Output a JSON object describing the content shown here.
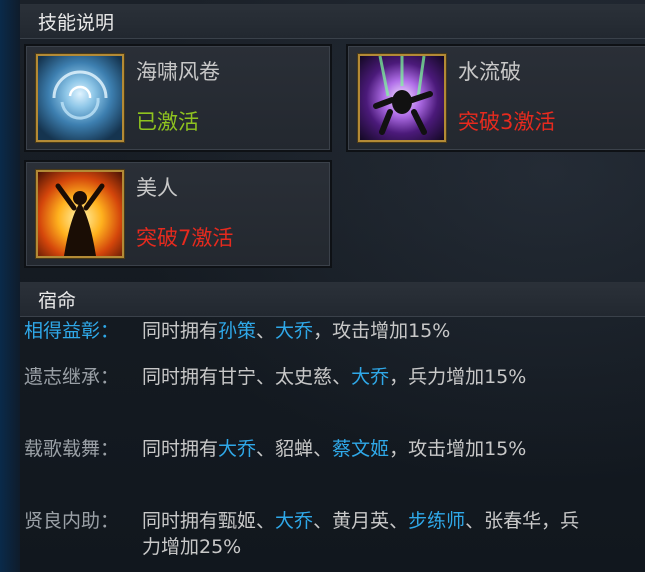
{
  "sections": {
    "skills_title": "技能说明",
    "fate_title": "宿命"
  },
  "skills": [
    {
      "name": "海啸风卷",
      "status": "已激活",
      "state": "active",
      "icon": "water-vortex-icon"
    },
    {
      "name": "水流破",
      "status": "突破3激活",
      "state": "locked",
      "icon": "violet-burst-icon"
    },
    {
      "name": "美人",
      "status": "突破7激活",
      "state": "locked",
      "icon": "fire-dancer-icon"
    }
  ],
  "fates": [
    {
      "label": "相得益彰：",
      "label_active": true,
      "prefix": "同时拥有",
      "heroes": [
        {
          "name": "孙策",
          "owned": true
        },
        {
          "name": "大乔",
          "owned": true
        }
      ],
      "effect": "，攻击增加15%"
    },
    {
      "label": "遗志继承：",
      "label_active": false,
      "prefix": "同时拥有",
      "heroes": [
        {
          "name": "甘宁",
          "owned": false
        },
        {
          "name": "太史慈",
          "owned": false
        },
        {
          "name": "大乔",
          "owned": true
        }
      ],
      "effect": "，兵力增加15%"
    },
    {
      "label": "载歌载舞：",
      "label_active": false,
      "prefix": "同时拥有",
      "heroes": [
        {
          "name": "大乔",
          "owned": true
        },
        {
          "name": "貂蝉",
          "owned": false
        },
        {
          "name": "蔡文姬",
          "owned": true
        }
      ],
      "effect": "，攻击增加15%"
    },
    {
      "label": "贤良内助：",
      "label_active": false,
      "prefix": "同时拥有",
      "heroes": [
        {
          "name": "甄姬",
          "owned": false
        },
        {
          "name": "大乔",
          "owned": true
        },
        {
          "name": "黄月英",
          "owned": false
        },
        {
          "name": "步练师",
          "owned": true
        },
        {
          "name": "张春华",
          "owned": false
        }
      ],
      "effect": "，兵力增加25%"
    }
  ],
  "separator": "、",
  "colors": {
    "active": "#8fc31f",
    "locked": "#e62a1e",
    "highlight": "#2fa8e8",
    "text": "#c8c8c8"
  }
}
